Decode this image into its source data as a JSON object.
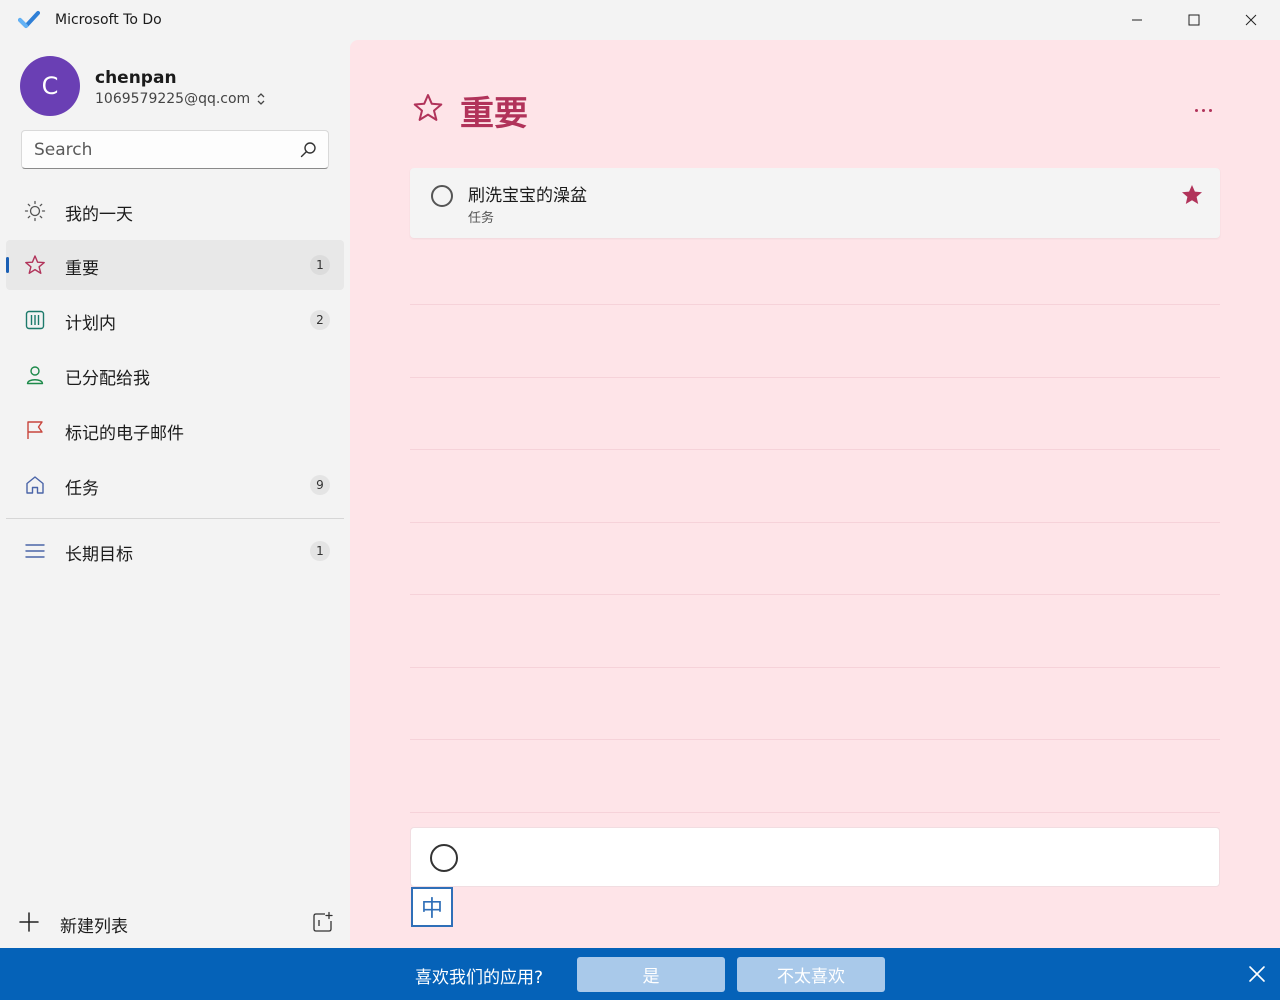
{
  "window": {
    "title": "Microsoft To Do"
  },
  "account": {
    "initial": "C",
    "name": "chenpan",
    "email": "1069579225@qq.com",
    "avatar_color": "#6a3fb4"
  },
  "search": {
    "placeholder": "Search"
  },
  "nav": [
    {
      "label": "我的一天",
      "icon": "sun-icon",
      "count": ""
    },
    {
      "label": "重要",
      "icon": "star-icon",
      "count": "1",
      "selected": true
    },
    {
      "label": "计划内",
      "icon": "calendar-icon",
      "count": "2"
    },
    {
      "label": "已分配给我",
      "icon": "person-icon",
      "count": ""
    },
    {
      "label": "标记的电子邮件",
      "icon": "flag-icon",
      "count": ""
    },
    {
      "label": "任务",
      "icon": "home-icon",
      "count": "9"
    }
  ],
  "lists": [
    {
      "label": "长期目标",
      "icon": "list-icon",
      "count": "1"
    }
  ],
  "new_list": {
    "label": "新建列表"
  },
  "main": {
    "title": "重要",
    "accent": "#b1335a",
    "background": "#fee4e8",
    "tasks": [
      {
        "title": "刷洗宝宝的澡盆",
        "list": "任务",
        "important": true
      }
    ],
    "add_task_value": ""
  },
  "ime": {
    "indicator": "中"
  },
  "feedback": {
    "question": "喜欢我们的应用?",
    "yes": "是",
    "no": "不太喜欢"
  }
}
